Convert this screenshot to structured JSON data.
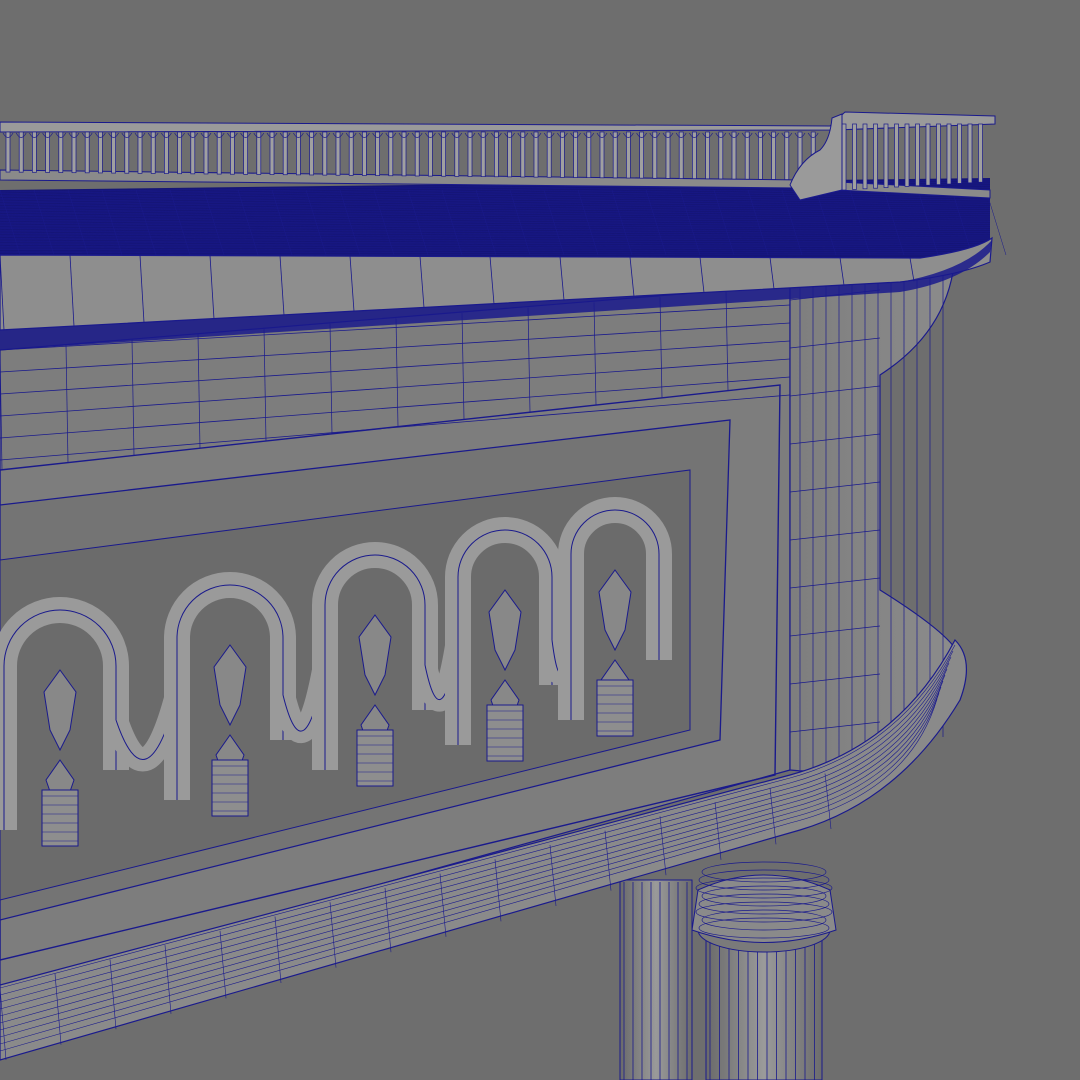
{
  "scene": {
    "subject": "",
    "background_color": "#6e6e6e",
    "surface_color": "#7d7d7d",
    "surface_light": "#8a8a8a",
    "surface_dark": "#6f6f6f",
    "wire_color": "#1a1a8c",
    "wire_dense_color": "#0d0d78"
  }
}
